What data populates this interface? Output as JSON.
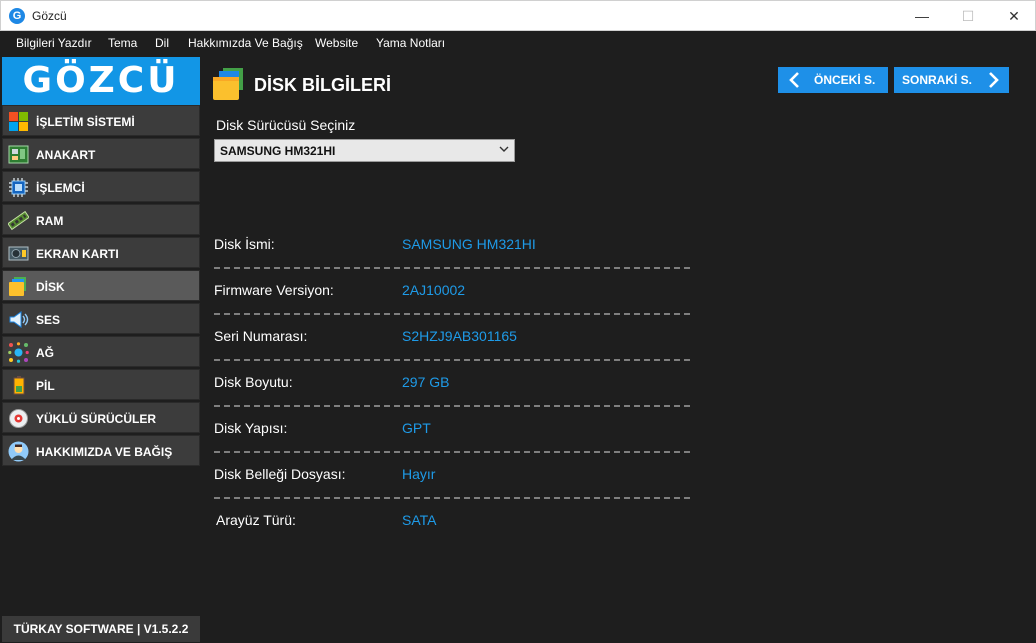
{
  "window": {
    "title": "Gözcü",
    "icon": "g-logo-icon"
  },
  "menu": [
    "Bilgileri Yazdır",
    "Tema",
    "Dil",
    "Hakkımızda Ve Bağış",
    "Website",
    "Yama Notları"
  ],
  "sidebar": {
    "logo": "GÖZCÜ",
    "items": [
      {
        "label": "İŞLETİM SİSTEMİ",
        "icon": "windows-icon"
      },
      {
        "label": "ANAKART",
        "icon": "motherboard-icon"
      },
      {
        "label": "İŞLEMCİ",
        "icon": "cpu-icon"
      },
      {
        "label": "RAM",
        "icon": "ram-icon"
      },
      {
        "label": "EKRAN KARTI",
        "icon": "gpu-icon"
      },
      {
        "label": "DİSK",
        "icon": "disk-icon",
        "active": true
      },
      {
        "label": "SES",
        "icon": "speaker-icon"
      },
      {
        "label": "AĞ",
        "icon": "network-icon"
      },
      {
        "label": "PİL",
        "icon": "battery-icon"
      },
      {
        "label": "YÜKLÜ SÜRÜCÜLER",
        "icon": "drivers-icon"
      },
      {
        "label": "HAKKIMIZDA VE BAĞIŞ",
        "icon": "user-avatar-icon"
      }
    ],
    "footer": "TÜRKAY SOFTWARE  |  V1.5.2.2"
  },
  "main": {
    "title": "DİSK BİLGİLERİ",
    "prev_label": "ÖNCEKİ S.",
    "next_label": "SONRAKİ S.",
    "select_label": "Disk Sürücüsü Seçiniz",
    "select_value": "SAMSUNG HM321HI",
    "rows": [
      {
        "label": "Disk İsmi:",
        "value": "SAMSUNG HM321HI"
      },
      {
        "label": "Firmware Versiyon:",
        "value": "2AJ10002"
      },
      {
        "label": "Seri Numarası:",
        "value": "S2HZJ9AB301165"
      },
      {
        "label": "Disk Boyutu:",
        "value": "297 GB"
      },
      {
        "label": "Disk Yapısı:",
        "value": "GPT"
      },
      {
        "label": "Disk Belleği Dosyası:",
        "value": "Hayır"
      },
      {
        "label": "Arayüz Türü:",
        "value": "SATA"
      }
    ]
  },
  "colors": {
    "accent": "#1e90e8",
    "value_text": "#1e9be8",
    "background": "#1e1e1e",
    "nav_item": "#3c3c3c",
    "nav_active": "#5a5a5a"
  }
}
